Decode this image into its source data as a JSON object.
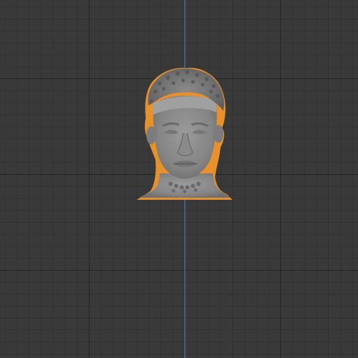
{
  "viewport": {
    "background_color": "#393939",
    "grid_major_color": "#2f2f2f",
    "grid_minor_color": "#353535",
    "y_axis_color": "#4a7fc7"
  },
  "object": {
    "type": "sculpted head mesh",
    "selected": true,
    "outline_color": "#e8902a",
    "mesh_color": "#8e8e8e"
  }
}
